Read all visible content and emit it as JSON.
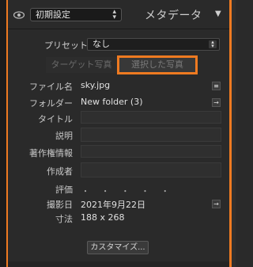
{
  "header": {
    "preset_value": "初期設定",
    "panel_title": "メタデータ"
  },
  "preset": {
    "label": "プリセット",
    "value": "なし"
  },
  "tabs": [
    {
      "label": "ターゲット写真"
    },
    {
      "label": "選択した写真"
    }
  ],
  "fields": {
    "file_name": {
      "label": "ファイル名",
      "value": "sky.jpg"
    },
    "folder": {
      "label": "フォルダー",
      "value": "New folder (3)"
    },
    "title": {
      "label": "タイトル",
      "value": ""
    },
    "caption": {
      "label": "説明",
      "value": ""
    },
    "copyright": {
      "label": "著作権情報",
      "value": ""
    },
    "creator": {
      "label": "作成者",
      "value": ""
    },
    "rating": {
      "label": "評価",
      "value": "・ ・ ・ ・ ・"
    },
    "capture_date": {
      "label": "撮影日",
      "value": "2021年9月22日"
    },
    "dimensions": {
      "label": "寸法",
      "value": "188 x 268"
    }
  },
  "customize_button": {
    "label": "カスタマイズ..."
  },
  "icons": {
    "eye": "eye-icon",
    "list": "list-icon",
    "arrow": "arrow-right-icon"
  },
  "colors": {
    "accent": "#ee7a21",
    "panel_bg": "#2a2a2a"
  }
}
